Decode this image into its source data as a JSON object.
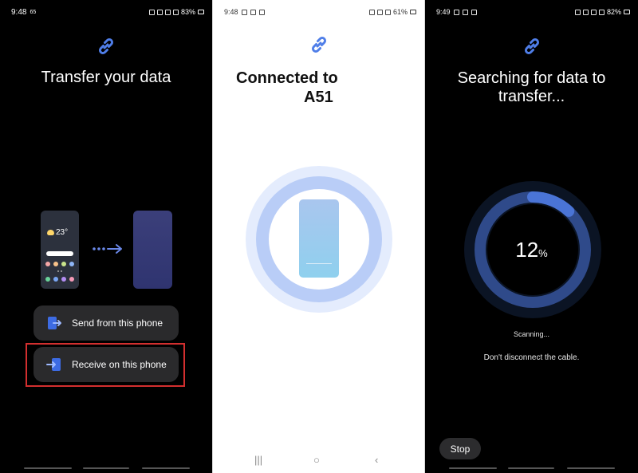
{
  "panel1": {
    "status": {
      "time": "9:48",
      "indicator": "65",
      "battery": "83%"
    },
    "title": "Transfer your data",
    "weather_temp": "23°",
    "buttons": [
      {
        "label": "Send from this phone",
        "icon": "send-icon"
      },
      {
        "label": "Receive on this phone",
        "icon": "receive-icon"
      }
    ],
    "highlight_color": "#d32f2f"
  },
  "panel2": {
    "status": {
      "time": "9:48",
      "battery": "61%"
    },
    "title_line1": "Connected to",
    "title_line2": "A51",
    "nav": {
      "recents": "|||",
      "home": "○",
      "back": "‹"
    }
  },
  "panel3": {
    "status": {
      "time": "9:49",
      "battery": "82%"
    },
    "title": "Searching for data to transfer...",
    "progress_value": "12",
    "progress_unit": "%",
    "progress_fraction": 0.12,
    "scanning_text": "Scanning...",
    "cable_text": "Don't disconnect the cable.",
    "stop_label": "Stop"
  },
  "colors": {
    "accent": "#3d6be3",
    "ring_dark": "#2f4a8a",
    "ring_light": "#c8d8f8"
  }
}
